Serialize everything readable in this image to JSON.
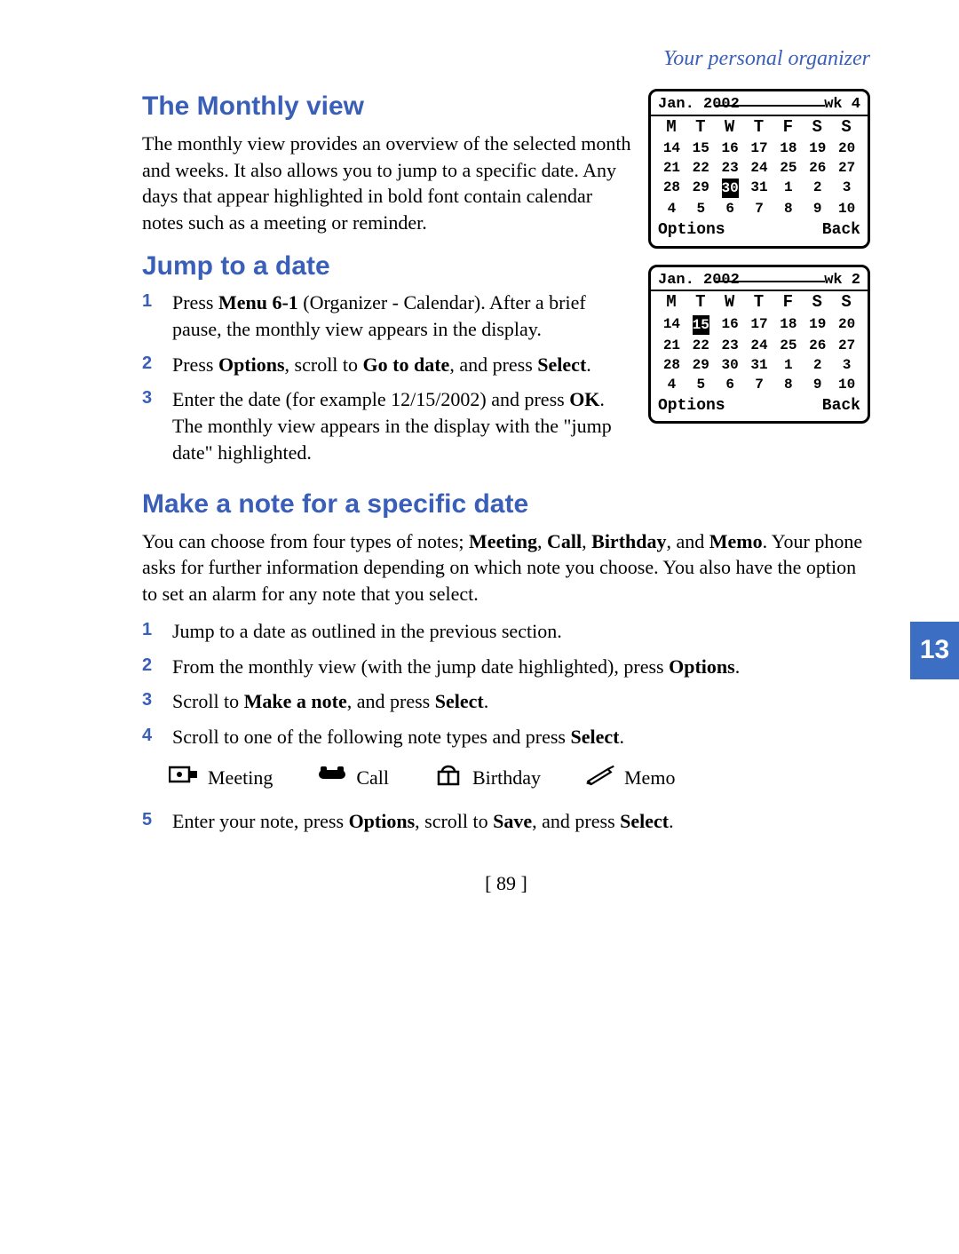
{
  "header": {
    "section_title": "Your personal organizer"
  },
  "page_tab": "13",
  "page_number": "[ 89 ]",
  "monthly_view": {
    "heading": "The Monthly view",
    "body": "The monthly view provides an overview of the selected month and weeks. It also allows you to jump to a specific date. Any days that appear highlighted in bold font contain calendar notes such as a meeting or reminder."
  },
  "jump": {
    "heading": "Jump to a date",
    "steps": [
      {
        "num": "1",
        "pre": "Press ",
        "bold1": "Menu 6-1",
        "post1": " (Organizer - Calendar). After a brief pause, the monthly view appears in the display."
      },
      {
        "num": "2",
        "pre": "Press ",
        "bold1": "Options",
        "mid1": ", scroll to ",
        "bold2": "Go to date",
        "mid2": ", and press ",
        "bold3": "Select",
        "post": "."
      },
      {
        "num": "3",
        "pre": "Enter the date (for example 12/15/2002) and press ",
        "bold1": "OK",
        "post1": ". The monthly view appears in the display with the \"jump date\" highlighted."
      }
    ]
  },
  "make_note": {
    "heading": "Make a note for a specific date",
    "intro_pre": "You can choose from four types of notes; ",
    "intro_bold1": "Meeting",
    "intro_sep1": ", ",
    "intro_bold2": "Call",
    "intro_sep2": ", ",
    "intro_bold3": "Birthday",
    "intro_sep3": ", and ",
    "intro_bold4": "Memo",
    "intro_post": ". Your phone asks for further information depending on which note you choose. You also have the option to set an alarm for any note that you select.",
    "steps": [
      {
        "num": "1",
        "text": "Jump to a date as outlined in the previous section."
      },
      {
        "num": "2",
        "pre": "From the monthly view (with the jump date highlighted), press ",
        "bold1": "Options",
        "post": "."
      },
      {
        "num": "3",
        "pre": "Scroll to ",
        "bold1": "Make a note",
        "mid1": ", and press ",
        "bold2": "Select",
        "post": "."
      },
      {
        "num": "4",
        "pre": "Scroll to one of the following note types and press ",
        "bold1": "Select",
        "post": "."
      },
      {
        "num": "5",
        "pre": "Enter your note, press ",
        "bold1": "Options",
        "mid1": ", scroll to ",
        "bold2": "Save",
        "mid2": ", and press ",
        "bold3": "Select",
        "post": "."
      }
    ],
    "types": {
      "meeting": "Meeting",
      "call": "Call",
      "birthday": "Birthday",
      "memo": "Memo"
    }
  },
  "phone1": {
    "month": "Jan. 2002",
    "week": "wk 4",
    "days": [
      "M",
      "T",
      "W",
      "T",
      "F",
      "S",
      "S"
    ],
    "rows": [
      [
        "14",
        "15",
        "16",
        "17",
        "18",
        "19",
        "20"
      ],
      [
        "21",
        "22",
        "23",
        "24",
        "25",
        "26",
        "27"
      ],
      [
        "28",
        "29",
        "30",
        "31",
        "1",
        "2",
        "3"
      ],
      [
        "4",
        "5",
        "6",
        "7",
        "8",
        "9",
        "10"
      ]
    ],
    "highlight_row": 2,
    "highlight_col": 2,
    "options": "Options",
    "back": "Back"
  },
  "phone2": {
    "month": "Jan. 2002",
    "week": "wk 2",
    "days": [
      "M",
      "T",
      "W",
      "T",
      "F",
      "S",
      "S"
    ],
    "rows": [
      [
        "14",
        "15",
        "16",
        "17",
        "18",
        "19",
        "20"
      ],
      [
        "21",
        "22",
        "23",
        "24",
        "25",
        "26",
        "27"
      ],
      [
        "28",
        "29",
        "30",
        "31",
        "1",
        "2",
        "3"
      ],
      [
        "4",
        "5",
        "6",
        "7",
        "8",
        "9",
        "10"
      ]
    ],
    "highlight_row": 0,
    "highlight_col": 1,
    "options": "Options",
    "back": "Back"
  }
}
